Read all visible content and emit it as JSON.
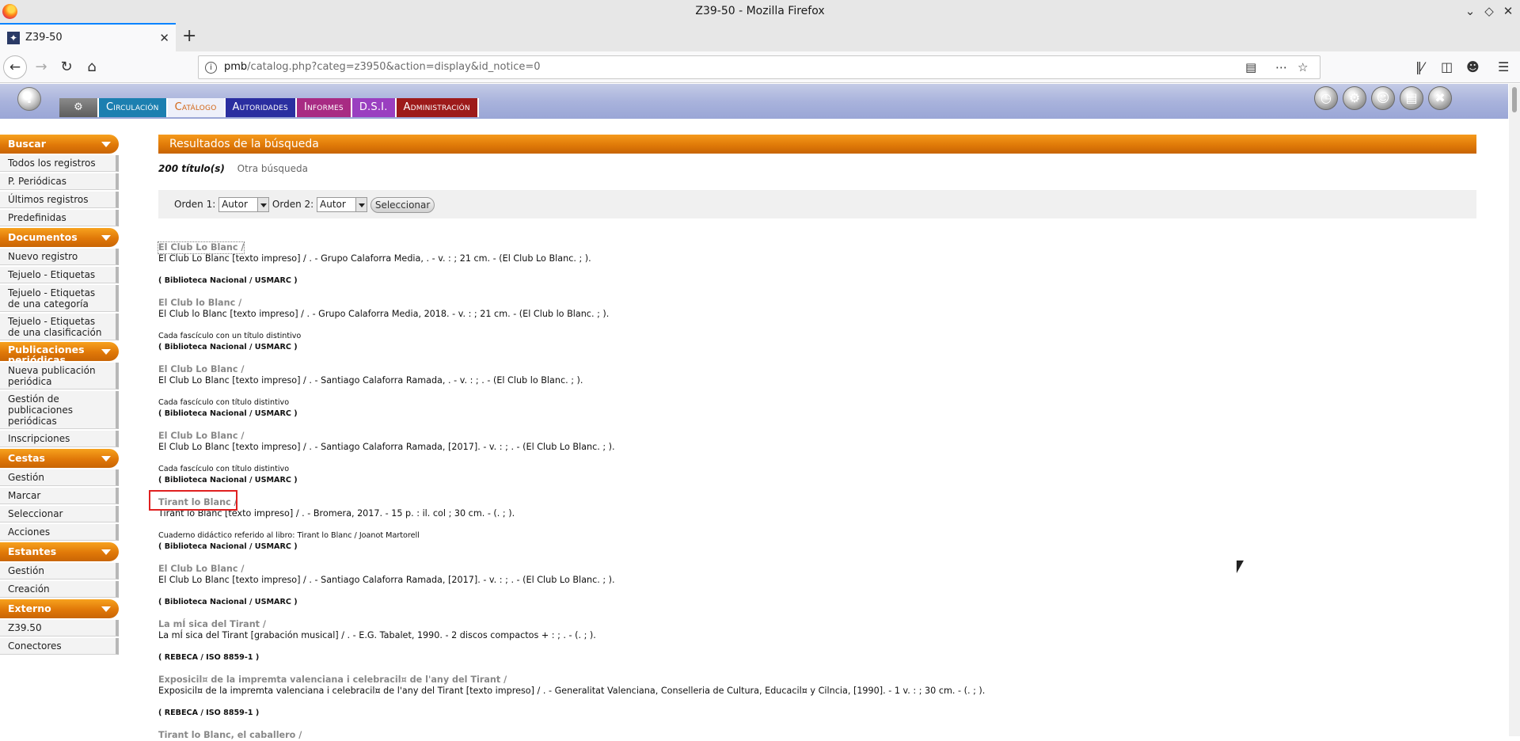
{
  "window": {
    "title": "Z39-50 - Mozilla Firefox"
  },
  "tab": {
    "title": "Z39-50"
  },
  "url": {
    "host": "pmb",
    "path": "/catalog.php?categ=z3950&action=display&id_notice=0"
  },
  "menu": {
    "circulacion": "Circulación",
    "catalogo": "Catálogo",
    "autoridades": "Autoridades",
    "informes": "Informes",
    "dsi": "D.S.I.",
    "administracion": "Administración"
  },
  "sidebar": {
    "buscar": {
      "title": "Buscar",
      "items": [
        "Todos los registros",
        "P. Periódicas",
        "Últimos registros",
        "Predefinidas"
      ]
    },
    "documentos": {
      "title": "Documentos",
      "items": [
        "Nuevo registro",
        "Tejuelo - Etiquetas",
        "Tejuelo - Etiquetas de una categoría",
        "Tejuelo - Etiquetas de una clasificación"
      ]
    },
    "publicaciones": {
      "title": "Publicaciones periódicas",
      "items": [
        "Nueva publicación periódica",
        "Gestión de publicaciones periódicas",
        "Inscripciones"
      ]
    },
    "cestas": {
      "title": "Cestas",
      "items": [
        "Gestión",
        "Marcar",
        "Seleccionar",
        "Acciones"
      ]
    },
    "estantes": {
      "title": "Estantes",
      "items": [
        "Gestión",
        "Creación"
      ]
    },
    "externo": {
      "title": "Externo",
      "items": [
        "Z39.50",
        "Conectores"
      ]
    }
  },
  "main": {
    "results_title": "Resultados de la búsqueda",
    "count": "200 título(s)",
    "other_search": "Otra búsqueda",
    "order1_label": "Orden 1:",
    "order1_value": "Autor",
    "order2_label": "Orden 2:",
    "order2_value": "Autor",
    "select_button": "Seleccionar"
  },
  "records": [
    {
      "title": "El Club Lo Blanc /",
      "desc": "El Club Lo Blanc [texto impreso] / . - Grupo Calaforra Media, . - v. : ; 21 cm. - (El Club Lo Blanc. ; ).",
      "note": "",
      "source": "( Biblioteca Nacional / USMARC )"
    },
    {
      "title": "El Club lo Blanc /",
      "desc": "El Club lo Blanc [texto impreso] / . - Grupo Calaforra Media, 2018. - v. : ; 21 cm. - (El Club lo Blanc. ; ).",
      "note": "Cada fascículo con un título distintivo",
      "source": "( Biblioteca Nacional / USMARC )"
    },
    {
      "title": "El Club Lo Blanc /",
      "desc": "El Club Lo Blanc [texto impreso] / . - Santiago Calaforra Ramada, . - v. : ; . - (El Club lo Blanc. ; ).",
      "note": "Cada fascículo con título distintivo",
      "source": "( Biblioteca Nacional / USMARC )"
    },
    {
      "title": "El Club Lo Blanc /",
      "desc": "El Club Lo Blanc [texto impreso] / . - Santiago Calaforra Ramada, [2017]. - v. : ; . - (El Club Lo Blanc. ; ).",
      "note": "Cada fascículo con título distintivo",
      "source": "( Biblioteca Nacional / USMARC )"
    },
    {
      "title": "Tirant lo Blanc /",
      "desc": "Tirant lo Blanc [texto impreso] / . - Bromera, 2017. - 15 p. : il. col ; 30 cm. - (. ; ).",
      "note": "Cuaderno didáctico referido al libro: Tirant lo Blanc / Joanot Martorell",
      "source": "( Biblioteca Nacional / USMARC )"
    },
    {
      "title": "El Club Lo Blanc /",
      "desc": "El Club Lo Blanc [texto impreso] / . - Santiago Calaforra Ramada, [2017]. - v. : ; . - (El Club Lo Blanc. ; ).",
      "note": "",
      "source": "( Biblioteca Nacional / USMARC )"
    },
    {
      "title": "La mÍ sica del Tirant /",
      "desc": "La mÍ sica del Tirant [grabación musical] / . - E.G. Tabalet, 1990. - 2 discos compactos + : ; . - (. ; ).",
      "note": "",
      "source": "( REBECA / ISO 8859-1 )"
    },
    {
      "title": "Exposicil¤ de la impremta valenciana i celebracil¤ de l'any del Tirant /",
      "desc": "Exposicil¤ de la impremta valenciana i celebracil¤ de l'any del Tirant [texto impreso] / . - Generalitat Valenciana, Conselleria de Cultura, Educacil¤ y Cilncia, [1990]. - 1 v. : ; 30 cm. - (. ; ).",
      "note": "",
      "source": "( REBECA / ISO 8859-1 )"
    },
    {
      "title": "Tirant lo Blanc, el caballero /",
      "desc": "",
      "note": "",
      "source": ""
    }
  ]
}
